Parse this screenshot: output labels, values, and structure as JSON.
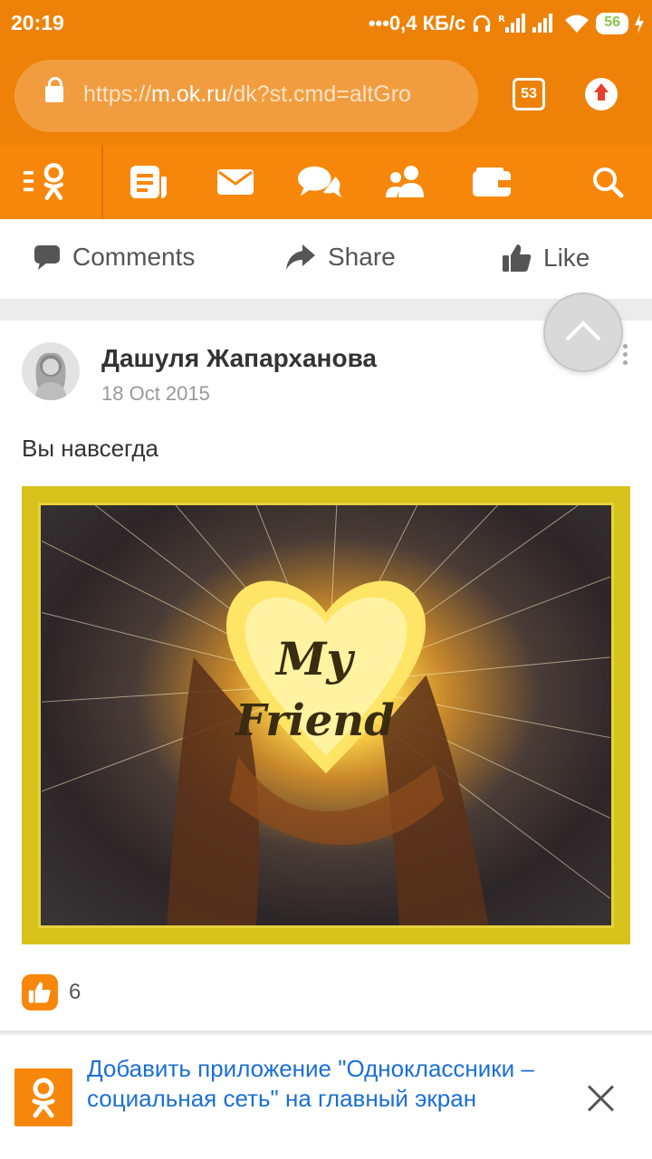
{
  "status_bar": {
    "time": "20:19",
    "net_speed": "•••0,4 КБ/с",
    "battery": "56"
  },
  "browser": {
    "url_scheme": "https://",
    "url_host": "m.ok.ru",
    "url_path": "/dk?st.cmd=altGro",
    "tabs_count": "53",
    "icons": [
      "lock-icon",
      "tabs-icon",
      "upload-icon"
    ]
  },
  "nav": {
    "items": [
      "ok-menu-icon",
      "feed-icon",
      "messages-icon",
      "discussions-icon",
      "friends-icon",
      "wallet-icon",
      "search-icon"
    ]
  },
  "actions": {
    "comments": "Comments",
    "share": "Share",
    "like": "Like"
  },
  "post": {
    "author": "Дашуля Жапарханова",
    "date": "18 Oct 2015",
    "text": "Вы навсегда",
    "image_text_line1": "My",
    "image_text_line2": "Friend",
    "likes_count": "6"
  },
  "banner": {
    "text": "Добавить приложение \"Одноклассники – социальная сеть\" на главный экран"
  },
  "colors": {
    "brand_orange": "#f7870b",
    "link_blue": "#1a6fd6"
  }
}
